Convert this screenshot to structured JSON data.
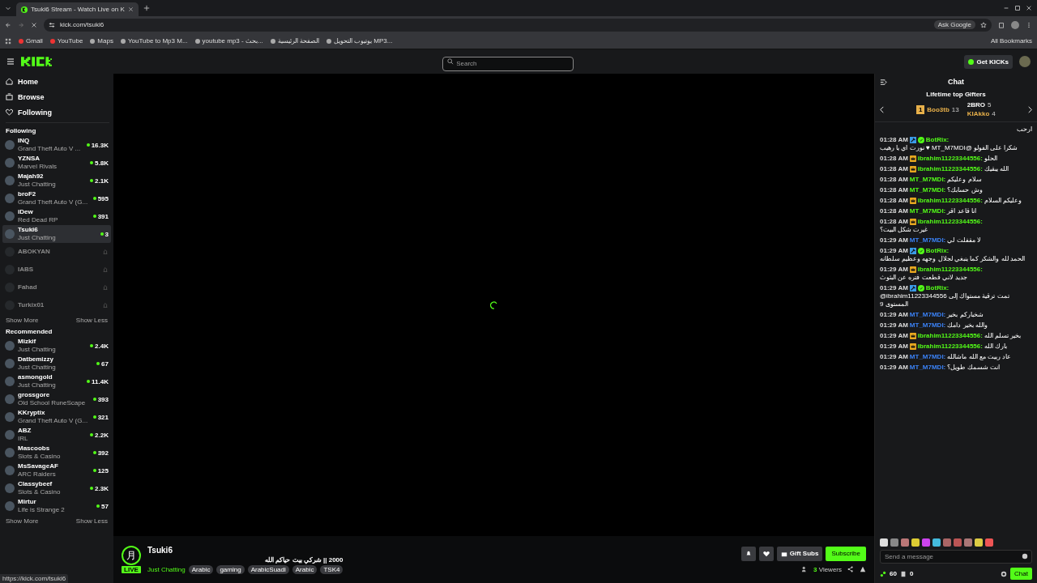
{
  "browser": {
    "tab_title": "Tsuki6 Stream - Watch Live on K",
    "url": "kick.com/tsuki6",
    "ask_button": "Ask Google",
    "bookmarks": [
      "Gmail",
      "YouTube",
      "Maps",
      "YouTube to Mp3 M...",
      "youtube mp3 - بحث...",
      "الصفحة الرئيسية",
      "يوتيوب التحويل MP3..."
    ],
    "all_bookmarks": "All Bookmarks",
    "status_url": "https://kick.com/tsuki6"
  },
  "header": {
    "search": {
      "placeholder": "Search"
    },
    "get_kicks": "Get KICKs"
  },
  "nav": [
    {
      "label": "Home"
    },
    {
      "label": "Browse"
    },
    {
      "label": "Following"
    }
  ],
  "following": {
    "title": "Following",
    "show_more": "Show More",
    "show_less": "Show Less",
    "items": [
      {
        "name": "INQ",
        "category": "Grand Theft Auto V ...",
        "viewers": "16.3K",
        "live": true,
        "selected": false
      },
      {
        "name": "YZNSA",
        "category": "Marvel Rivals",
        "viewers": "5.8K",
        "live": true,
        "selected": false
      },
      {
        "name": "Majah92",
        "category": "Just Chatting",
        "viewers": "2.1K",
        "live": true,
        "selected": false
      },
      {
        "name": "broF2",
        "category": "Grand Theft Auto V (G...",
        "viewers": "595",
        "live": true,
        "selected": false
      },
      {
        "name": "iDew",
        "category": "Red Dead RP",
        "viewers": "391",
        "live": true,
        "selected": false
      },
      {
        "name": "Tsuki6",
        "category": "Just Chatting",
        "viewers": "3",
        "live": true,
        "selected": true
      },
      {
        "name": "ABOKYAN",
        "live": false,
        "selected": false
      },
      {
        "name": "IABS",
        "live": false,
        "selected": false
      },
      {
        "name": "Fahad",
        "live": false,
        "selected": false
      },
      {
        "name": "Turkix01",
        "live": false,
        "selected": false
      }
    ]
  },
  "recommended": {
    "title": "Recommended",
    "show_more": "Show More",
    "show_less": "Show Less",
    "items": [
      {
        "name": "Mizkif",
        "category": "Just Chatting",
        "viewers": "2.4K"
      },
      {
        "name": "Datbemizzy",
        "category": "Just Chatting",
        "viewers": "67"
      },
      {
        "name": "asmongold",
        "category": "Just Chatting",
        "viewers": "11.4K"
      },
      {
        "name": "grossgore",
        "category": "Old School RuneScape",
        "viewers": "393"
      },
      {
        "name": "KKryptix",
        "category": "Grand Theft Auto V (G...",
        "viewers": "321"
      },
      {
        "name": "ABZ",
        "category": "IRL",
        "viewers": "2.2K"
      },
      {
        "name": "Mascoobs",
        "category": "Slots & Casino",
        "viewers": "392"
      },
      {
        "name": "MsSavageAF",
        "category": "ARC Raiders",
        "viewers": "125"
      },
      {
        "name": "Classybeef",
        "category": "Slots & Casino",
        "viewers": "2.3K"
      },
      {
        "name": "Mirtur",
        "category": "Life is Strange 2",
        "viewers": "57"
      }
    ]
  },
  "channel": {
    "name": "Tsuki6",
    "avatar_glyph": "月",
    "live_badge": "LIVE",
    "title": "2000 || شركي بيت حياكم الله",
    "category": "Just Chatting",
    "tags": [
      "Arabic",
      "gaming",
      "ArabicSuadi",
      "Arabic",
      "TSK4"
    ],
    "gift_button": "Gift Subs",
    "subscribe_button": "Subscribe",
    "viewer_count": "3",
    "viewers_label": "Viewers"
  },
  "chat": {
    "title": "Chat",
    "gifters_title": "Lifetime top Gifters",
    "gifters": [
      {
        "rank": "1",
        "name": "Boo3tb",
        "count": "13",
        "color": "#e8b04a"
      },
      {
        "name": "2BRO",
        "count": "5",
        "color": "#ffffff"
      },
      {
        "name": "KIAkko",
        "count": "4",
        "color": "#e8b04a"
      }
    ],
    "messages": [
      {
        "kind": "continuation",
        "text": "ارحب"
      },
      {
        "kind": "message",
        "time": "01:28 AM",
        "bot": true,
        "verified": true,
        "crown": false,
        "user": "BotRix:",
        "color": "#53fc18",
        "text": "شكرا على الفولو @MT_M7MDI ♥ نورت اي يا رهيب"
      },
      {
        "kind": "message",
        "time": "01:28 AM",
        "bot": false,
        "verified": false,
        "crown": true,
        "user": "ibrahim11223344556:",
        "color": "#53fc18",
        "text": "الحلو"
      },
      {
        "kind": "message",
        "time": "01:28 AM",
        "bot": false,
        "verified": false,
        "crown": true,
        "user": "ibrahim11223344556:",
        "color": "#53fc18",
        "text": "الله يبقيك"
      },
      {
        "kind": "message",
        "time": "01:28 AM",
        "bot": false,
        "verified": false,
        "crown": false,
        "user": "MT_M7MDI:",
        "color": "#53fc18",
        "text": "سلام وعليكم"
      },
      {
        "kind": "message",
        "time": "01:28 AM",
        "bot": false,
        "verified": false,
        "crown": false,
        "user": "MT_M7MDI:",
        "color": "#53fc18",
        "text": "وش حسابك؟"
      },
      {
        "kind": "message",
        "time": "01:28 AM",
        "bot": false,
        "verified": false,
        "crown": true,
        "user": "ibrahim11223344556:",
        "color": "#53fc18",
        "text": "وعليكم السلام"
      },
      {
        "kind": "message",
        "time": "01:28 AM",
        "bot": false,
        "verified": false,
        "crown": false,
        "user": "MT_M7MDI:",
        "color": "#53fc18",
        "text": "انا قاعد اقر"
      },
      {
        "kind": "message",
        "time": "01:28 AM",
        "bot": false,
        "verified": false,
        "crown": true,
        "user": "ibrahim11223344556:",
        "color": "#53fc18",
        "text": "غيرت شكل البيت؟"
      },
      {
        "kind": "message",
        "time": "01:29 AM",
        "bot": false,
        "verified": false,
        "crown": false,
        "user": "MT_M7MDI:",
        "color": "#3b82f6",
        "text": "لا مقفلت لي"
      },
      {
        "kind": "message",
        "time": "01:29 AM",
        "bot": true,
        "verified": true,
        "crown": false,
        "user": "BotRix:",
        "color": "#53fc18",
        "text": "الحمد لله والشكر كما ينبغي لجلال وجهه وعظيم سلطانه"
      },
      {
        "kind": "message",
        "time": "01:29 AM",
        "bot": false,
        "verified": false,
        "crown": true,
        "user": "ibrahim11223344556:",
        "color": "#53fc18",
        "text": "جديد لاني قطعت فتره عن البثوث"
      },
      {
        "kind": "message",
        "time": "01:29 AM",
        "bot": true,
        "verified": true,
        "crown": false,
        "user": "BotRix:",
        "color": "#53fc18",
        "text": "@ibrahim11223344556 تمت ترقية مستواك إلى المستوى 9"
      },
      {
        "kind": "message",
        "time": "01:29 AM",
        "bot": false,
        "verified": false,
        "crown": false,
        "user": "MT_M7MDI:",
        "color": "#3b82f6",
        "text": "شخباركم بخير"
      },
      {
        "kind": "message",
        "time": "01:29 AM",
        "bot": false,
        "verified": false,
        "crown": false,
        "user": "MT_M7MDI:",
        "color": "#3b82f6",
        "text": "والله بخير دامك"
      },
      {
        "kind": "message",
        "time": "01:29 AM",
        "bot": false,
        "verified": false,
        "crown": true,
        "user": "ibrahim11223344556:",
        "color": "#53fc18",
        "text": "بخير تسلم الله"
      },
      {
        "kind": "message",
        "time": "01:29 AM",
        "bot": false,
        "verified": false,
        "crown": true,
        "user": "ibrahim11223344556:",
        "color": "#53fc18",
        "text": "بارك الله"
      },
      {
        "kind": "message",
        "time": "01:29 AM",
        "bot": false,
        "verified": false,
        "crown": false,
        "user": "MT_M7MDI:",
        "color": "#3b82f6",
        "text": "عاد ربيت مع الله ماشالله"
      },
      {
        "kind": "message",
        "time": "01:29 AM",
        "bot": false,
        "verified": false,
        "crown": false,
        "user": "MT_M7MDI:",
        "color": "#3b82f6",
        "text": "انت شسمك طويل؟"
      }
    ],
    "input": {
      "placeholder": "Send a message"
    },
    "points": "60",
    "drops": "0",
    "send_button": "Chat"
  }
}
